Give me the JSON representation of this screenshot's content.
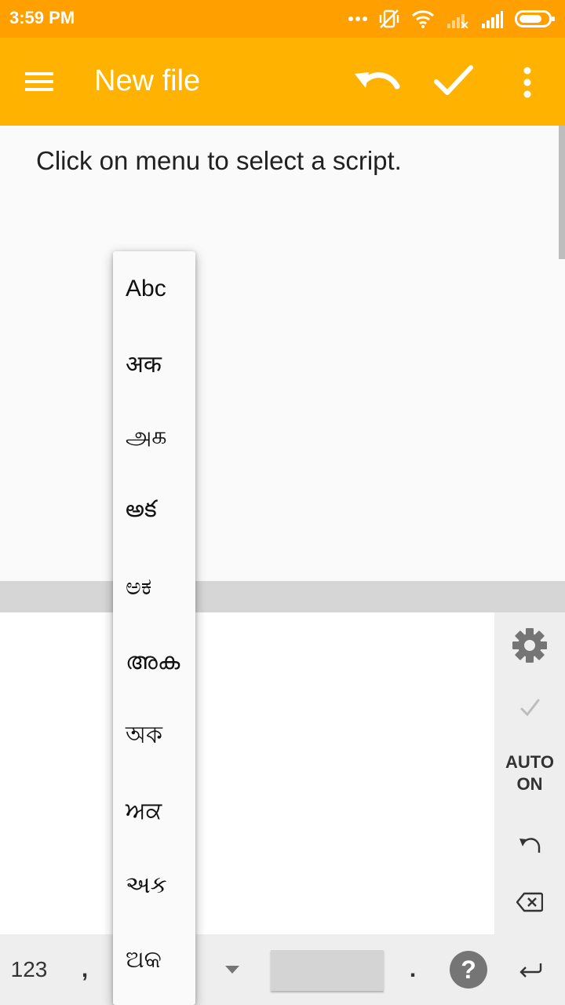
{
  "status_bar": {
    "time": "3:59 PM",
    "icons": [
      "more-dots-icon",
      "vibrate-off-icon",
      "wifi-icon",
      "signal-no-service-icon",
      "signal-icon",
      "battery-icon"
    ]
  },
  "app_bar": {
    "title": "New file",
    "icons": [
      "menu-icon",
      "undo-icon",
      "check-icon",
      "more-vert-icon"
    ]
  },
  "editor": {
    "hint_text": "Click on menu to select a script."
  },
  "script_menu": {
    "items": [
      "Abc",
      "अक",
      "அக",
      "అక",
      "ಅಕ",
      "അക",
      "অক",
      "ਅਕ",
      "અક",
      "ଅକ"
    ]
  },
  "side_panel": {
    "settings_icon": "gear-icon",
    "confirm_icon": "check-icon",
    "auto_line1": "AUTO",
    "auto_line2": "ON",
    "undo_icon": "undo-icon",
    "backspace_icon": "backspace-icon"
  },
  "keyboard_bottom_row": {
    "numbers_key": "123",
    "comma_key": ",",
    "period_key": ".",
    "help_key": "?",
    "enter_icon": "enter-icon",
    "dropdown_icon": "triangle-down-icon"
  },
  "colors": {
    "status_bar": "#ffa000",
    "app_bar": "#ffb300",
    "editor_bg": "#fafafa",
    "keyboard_bg": "#ffffff",
    "panel_bg": "#eeeeee"
  }
}
